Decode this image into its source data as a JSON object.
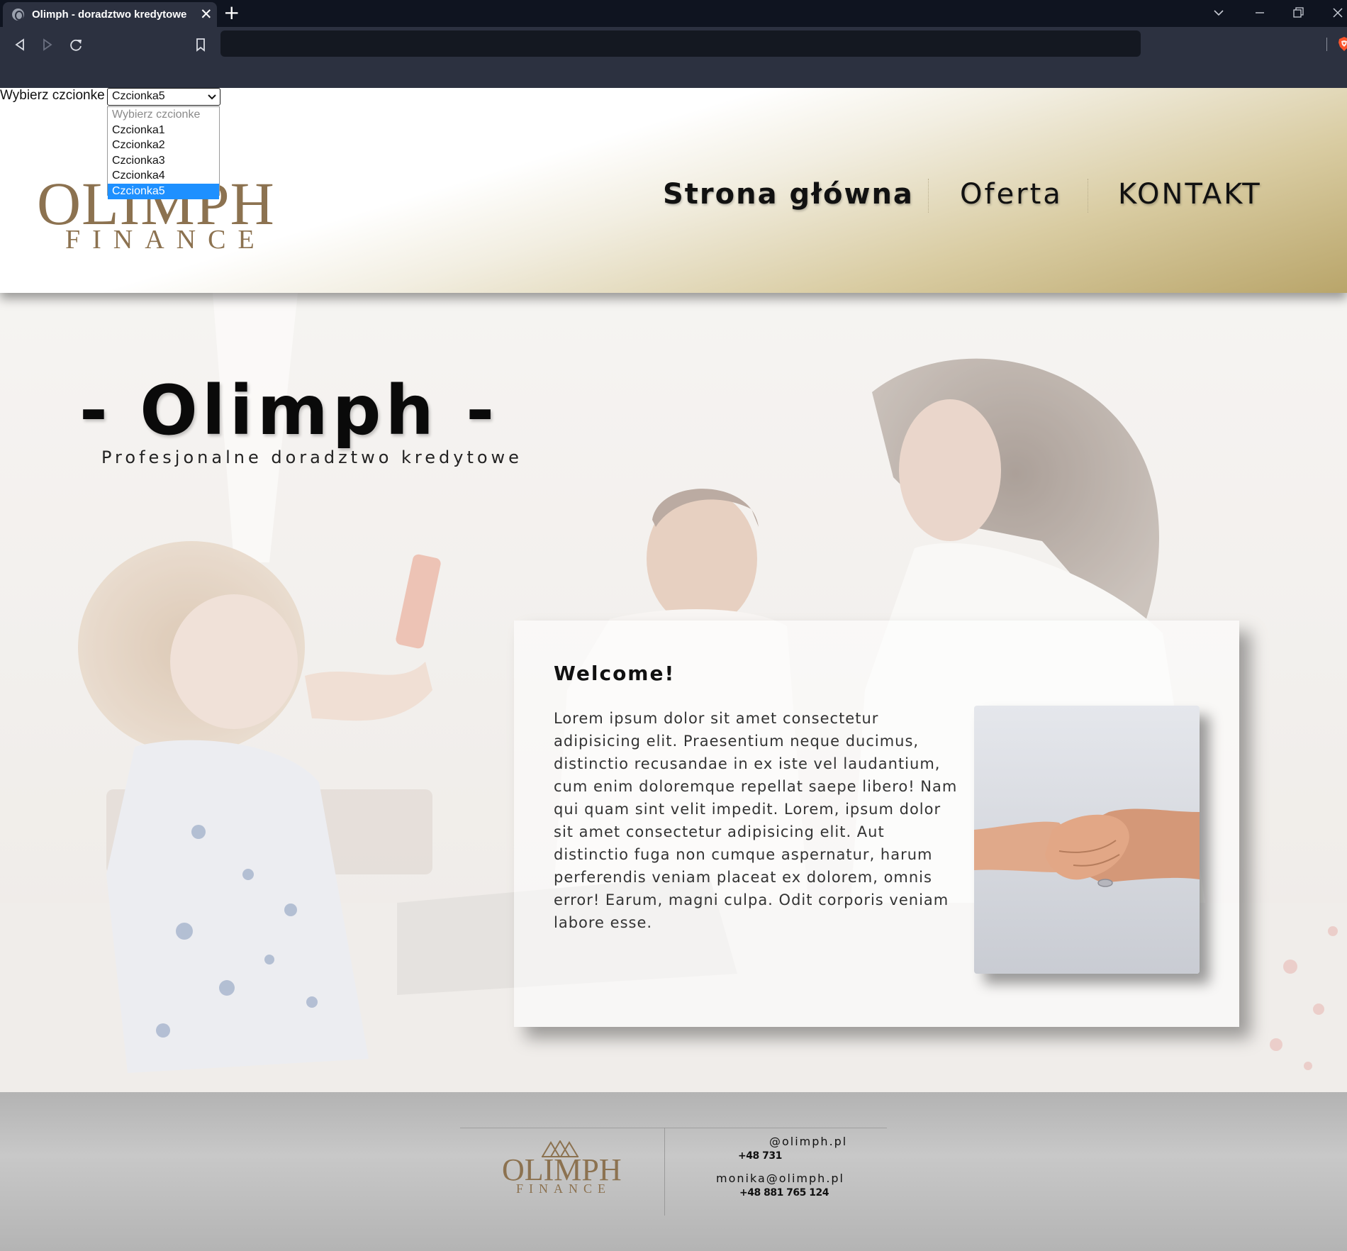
{
  "browser": {
    "tab_title": "Olimph - doradztwo kredytowe",
    "tab_close": "✕",
    "new_tab": "+",
    "icons": [
      "globe-icon",
      "close-icon",
      "plus-icon",
      "chevron-down-icon",
      "minimize-icon",
      "restore-icon",
      "close-window-icon",
      "back-icon",
      "forward-icon",
      "reload-icon",
      "bookmark-icon",
      "brave-shield-icon"
    ],
    "address_value": ""
  },
  "font_picker": {
    "label": "Wybierz czcionke",
    "selected": "Czcionka5",
    "options": [
      "Wybierz czcionke",
      "Czcionka1",
      "Czcionka2",
      "Czcionka3",
      "Czcionka4",
      "Czcionka5"
    ]
  },
  "header": {
    "logo_main": "OLIMPH",
    "logo_sub": "FINANCE",
    "nav": [
      "Strona główna",
      "Oferta",
      "KONTAKT"
    ]
  },
  "hero": {
    "title": "- Olimph -",
    "subtitle": "Profesjonalne doradztwo kredytowe"
  },
  "welcome": {
    "title": "Welcome!",
    "text": "Lorem ipsum dolor sit amet consectetur adipisicing elit. Praesentium neque ducimus, distinctio recusandae in ex iste vel laudantium, cum enim doloremque repellat saepe libero! Nam qui quam sint velit impedit. Lorem, ipsum dolor sit amet consectetur adipisicing elit. Aut distinctio fuga non cumque aspernatur, harum perferendis veniam placeat ex dolorem, omnis error! Earum, magni culpa. Odit corporis veniam labore esse."
  },
  "footer": {
    "logo_main": "OLIMPH",
    "logo_sub": "FINANCE",
    "email1": "@olimph.pl",
    "phone1": "+48 731",
    "email2": "monika@olimph.pl",
    "phone2": "+48 881 765 124"
  },
  "colors": {
    "brand_gold": "#8c7250",
    "header_gradient_end": "#b9a56a",
    "select_highlight": "#1e90ff",
    "chrome_dark": "#0f1420",
    "chrome_toolbar": "#2c3140"
  }
}
